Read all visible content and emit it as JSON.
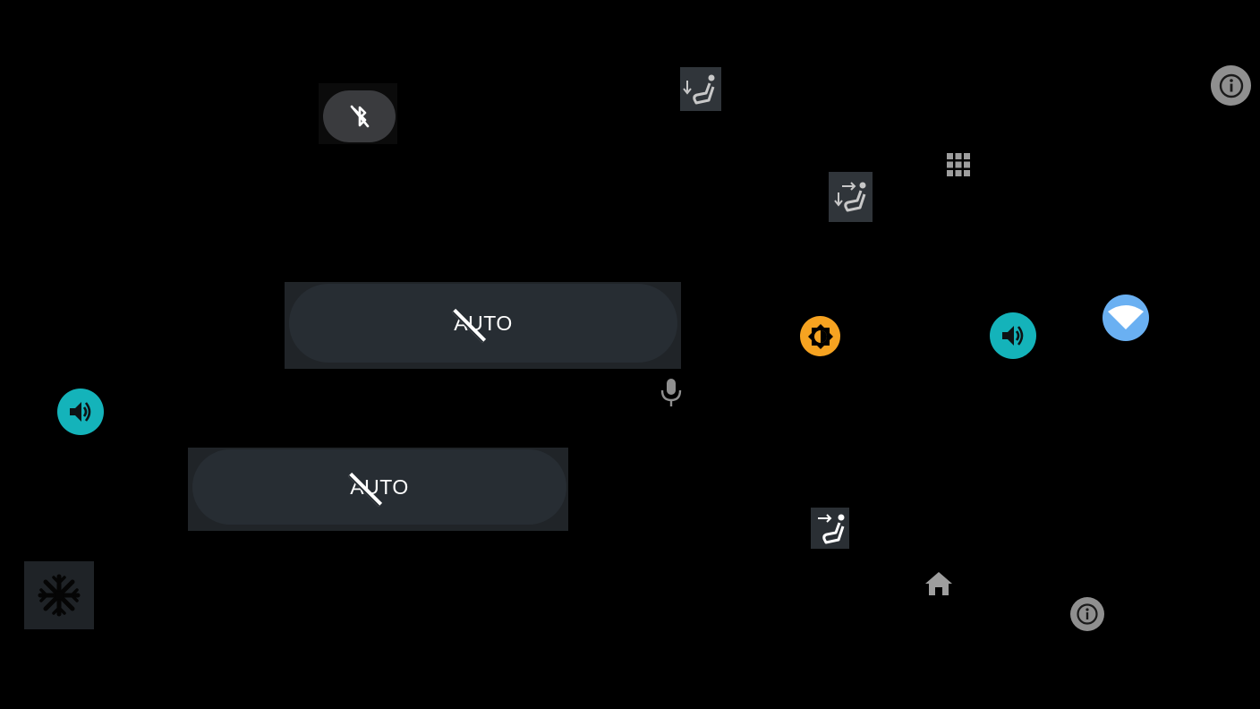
{
  "controls": {
    "bluetooth": {
      "icon": "bluetooth-off-icon",
      "state": "off"
    },
    "auto_climate_1": {
      "label": "AUTO",
      "state": "off"
    },
    "auto_climate_2": {
      "label": "AUTO",
      "state": "off"
    },
    "seat_airflow": [
      {
        "icon": "seat-airflow-down-icon"
      },
      {
        "icon": "seat-airflow-forward-down-icon"
      },
      {
        "icon": "seat-airflow-forward-icon"
      }
    ],
    "volume": [
      {
        "icon": "speaker-volume-icon"
      },
      {
        "icon": "speaker-volume-icon"
      }
    ],
    "brightness": {
      "icon": "brightness-icon"
    },
    "wifi": {
      "icon": "wifi-icon"
    },
    "microphone": {
      "icon": "microphone-icon"
    },
    "app_grid": {
      "icon": "app-grid-icon"
    },
    "home": {
      "icon": "home-icon"
    },
    "info": [
      {
        "icon": "info-icon"
      },
      {
        "icon": "info-icon"
      }
    ],
    "defrost": {
      "icon": "snowflake-icon"
    }
  },
  "colors": {
    "background": "#000000",
    "teal": "#14b3ba",
    "orange": "#f6a321",
    "blue": "#6ab0f2",
    "pill": "#272d33",
    "tile": "#30353a",
    "icon_grey": "#9e9e9e"
  }
}
